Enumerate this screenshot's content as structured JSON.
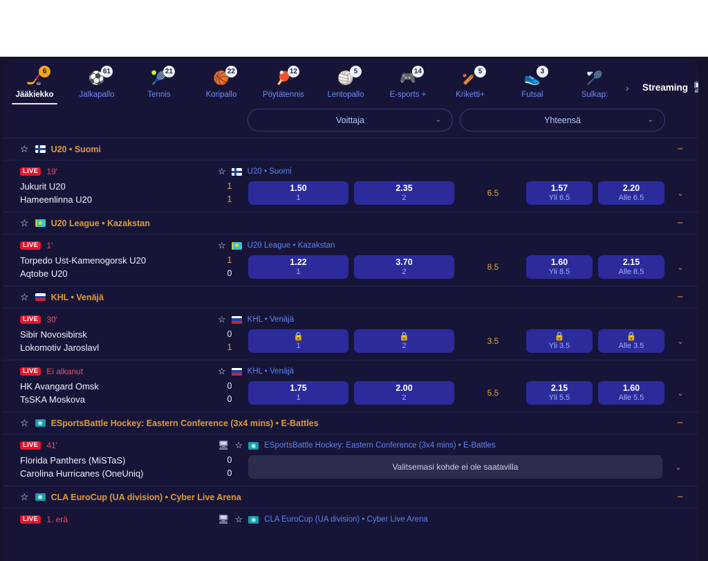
{
  "nav": {
    "sports": [
      {
        "label": "Jääkiekko",
        "count": "6",
        "icon": "hockey-icon",
        "active": true
      },
      {
        "label": "Jalkapallo",
        "count": "61",
        "icon": "football-icon",
        "active": false
      },
      {
        "label": "Tennis",
        "count": "21",
        "icon": "tennis-icon",
        "active": false
      },
      {
        "label": "Koripallo",
        "count": "22",
        "icon": "basketball-icon",
        "active": false
      },
      {
        "label": "Pöytätennis",
        "count": "12",
        "icon": "table-tennis-icon",
        "active": false
      },
      {
        "label": "Lentopallo",
        "count": "5",
        "icon": "volleyball-icon",
        "active": false
      },
      {
        "label": "E-sports +",
        "count": "14",
        "icon": "esports-icon",
        "active": false
      },
      {
        "label": "Kriketti+",
        "count": "5",
        "icon": "cricket-icon",
        "active": false
      },
      {
        "label": "Futsal",
        "count": "3",
        "icon": "futsal-icon",
        "active": false
      },
      {
        "label": "Sulkap:",
        "count": "",
        "icon": "badminton-icon",
        "active": false
      }
    ],
    "more_chevron": "›",
    "streaming_label": "Streaming",
    "tv_icon": "tv-icon",
    "toggle_on": false
  },
  "filters": [
    {
      "name": "winner-filter",
      "value": "Voittaja",
      "chevron": "⌄"
    },
    {
      "name": "total-filter",
      "value": "Yhteensä",
      "chevron": "⌄"
    }
  ],
  "icons": {
    "star": "☆",
    "collapse": "−",
    "chevron_down": "⌄",
    "lock": "🔒",
    "tv": "🖵"
  },
  "leagues": [
    {
      "title": "U20 • Suomi",
      "flag": "fi",
      "matches": [
        {
          "status": "LIVE",
          "time": "19'",
          "league": "U20 • Suomi",
          "flag": "fi",
          "has_tv": false,
          "teams": [
            "Jukurit U20",
            "Hameenlinna U20"
          ],
          "scores": [
            "1",
            "1"
          ],
          "odds": [
            {
              "v": "1.50",
              "k": "1",
              "locked": false
            },
            {
              "v": "2.35",
              "k": "2",
              "locked": false
            }
          ],
          "handicap": "6.5",
          "totals": [
            {
              "v": "1.57",
              "k": "Yli 6.5",
              "locked": false
            },
            {
              "v": "2.20",
              "k": "Alle 6.5",
              "locked": false
            }
          ],
          "unavailable": null
        }
      ]
    },
    {
      "title": "U20 League • Kazakstan",
      "flag": "kz",
      "matches": [
        {
          "status": "LIVE",
          "time": "1'",
          "league": "U20 League • Kazakstan",
          "flag": "kz",
          "has_tv": false,
          "teams": [
            "Torpedo Ust-Kamenogorsk U20",
            "Aqtobe U20"
          ],
          "scores": [
            "1",
            "0"
          ],
          "odds": [
            {
              "v": "1.22",
              "k": "1",
              "locked": false
            },
            {
              "v": "3.70",
              "k": "2",
              "locked": false
            }
          ],
          "handicap": "8.5",
          "totals": [
            {
              "v": "1.60",
              "k": "Yli 8.5",
              "locked": false
            },
            {
              "v": "2.15",
              "k": "Alle 8.5",
              "locked": false
            }
          ],
          "unavailable": null
        }
      ]
    },
    {
      "title": "KHL • Venäjä",
      "flag": "ru",
      "matches": [
        {
          "status": "LIVE",
          "time": "30'",
          "league": "KHL • Venäjä",
          "flag": "ru",
          "has_tv": false,
          "teams": [
            "Sibir Novosibirsk",
            "Lokomotiv Jaroslavl"
          ],
          "scores": [
            "0",
            "1"
          ],
          "odds": [
            {
              "v": "",
              "k": "1",
              "locked": true
            },
            {
              "v": "",
              "k": "2",
              "locked": true
            }
          ],
          "handicap": "3.5",
          "totals": [
            {
              "v": "",
              "k": "Yli 3.5",
              "locked": true
            },
            {
              "v": "",
              "k": "Alle 3.5",
              "locked": true
            }
          ],
          "unavailable": null
        },
        {
          "status": "LIVE",
          "time": "Ei alkanut",
          "league": "KHL • Venäjä",
          "flag": "ru",
          "has_tv": false,
          "teams": [
            "HK Avangard Omsk",
            "TsSKA Moskova"
          ],
          "scores": [
            "0",
            "0"
          ],
          "odds": [
            {
              "v": "1.75",
              "k": "1",
              "locked": false
            },
            {
              "v": "2.00",
              "k": "2",
              "locked": false
            }
          ],
          "handicap": "5.5",
          "totals": [
            {
              "v": "2.15",
              "k": "Yli 5.5",
              "locked": false
            },
            {
              "v": "1.60",
              "k": "Alle 5.5",
              "locked": false
            }
          ],
          "unavailable": null
        }
      ]
    },
    {
      "title": "ESportsBattle Hockey: Eastern Conference (3x4 mins) • E-Battles",
      "flag": "eb",
      "matches": [
        {
          "status": "LIVE",
          "time": "41'",
          "league": "ESportsBattle Hockey: Eastern Conference (3x4 mins) • E-Battles",
          "flag": "eb",
          "has_tv": true,
          "teams": [
            "Florida Panthers (MiSTaS)",
            "Carolina Hurricanes (OneUniq)"
          ],
          "scores": [
            "0",
            "0"
          ],
          "odds": [],
          "handicap": "",
          "totals": [],
          "unavailable": "Valitsemasi kohde ei ole saatavilla"
        }
      ]
    },
    {
      "title": "CLA EuroCup (UA division) • Cyber Live Arena",
      "flag": "eb",
      "matches": [
        {
          "status": "LIVE",
          "time": "1. erä",
          "league": "CLA EuroCup (UA division) • Cyber Live Arena",
          "flag": "eb",
          "has_tv": true,
          "teams": [],
          "scores": [],
          "odds": [],
          "handicap": "",
          "totals": [],
          "unavailable": null
        }
      ]
    }
  ],
  "colors": {
    "background": "#161538",
    "accent_orange": "#e09a3a",
    "odds_blue": "#2b2b9c",
    "live_red": "#e8152c",
    "link_blue": "#5f82ef"
  }
}
